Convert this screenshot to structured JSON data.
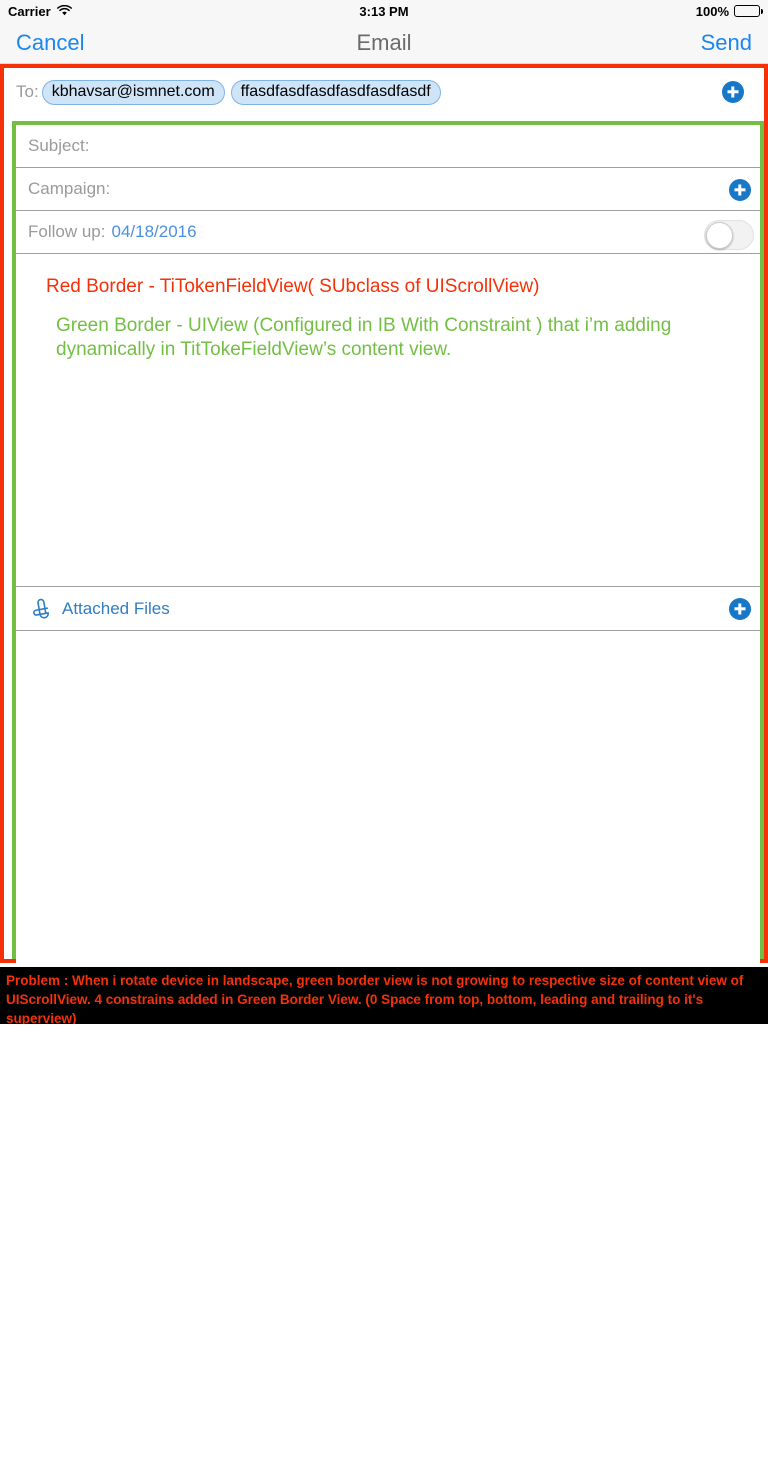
{
  "status_bar": {
    "carrier": "Carrier",
    "wifi_icon": "wifi-icon",
    "time": "3:13 PM",
    "battery_percent": "100%",
    "battery_icon": "battery-full-icon"
  },
  "nav_bar": {
    "cancel_label": "Cancel",
    "title": "Email",
    "send_label": "Send"
  },
  "compose": {
    "to": {
      "label": "To:",
      "tokens": [
        "kbhavsar@ismnet.com",
        "ffasdfasdfasdfasdfasdfasdf"
      ],
      "add_icon": "plus-circle-icon"
    },
    "subject": {
      "label": "Subject:",
      "value": ""
    },
    "campaign": {
      "label": "Campaign:",
      "value": "",
      "add_icon": "plus-circle-icon"
    },
    "follow_up": {
      "label": "Follow up:",
      "date": "04/18/2016",
      "toggle_state": "off"
    },
    "attachments": {
      "icon": "paperclip-icon",
      "label": "Attached Files",
      "add_icon": "plus-circle-icon"
    }
  },
  "annotations": {
    "red_note": "Red Border - TiTokenFieldView( SUbclass of UIScrollView)",
    "green_note": "Green Border - UIView (Configured in IB With Constraint ) that i’m adding dynamically in TitTokeFieldView’s content view.",
    "problem_note": "Problem : When i rotate device in landscape, green border view is not growing to respective size of content view of UIScrollView. 4 constrains added in Green Border View. (0 Space from top, bottom, leading and trailing to it's superview)"
  },
  "colors": {
    "red_border": "#f53109",
    "green_border": "#73bf44",
    "accent_blue": "#1c86ee",
    "token_fill": "#cfe4f7",
    "token_border": "#7fb4e8",
    "plus_blue": "#1878c8",
    "placeholder_gray": "#9a9a9a"
  }
}
